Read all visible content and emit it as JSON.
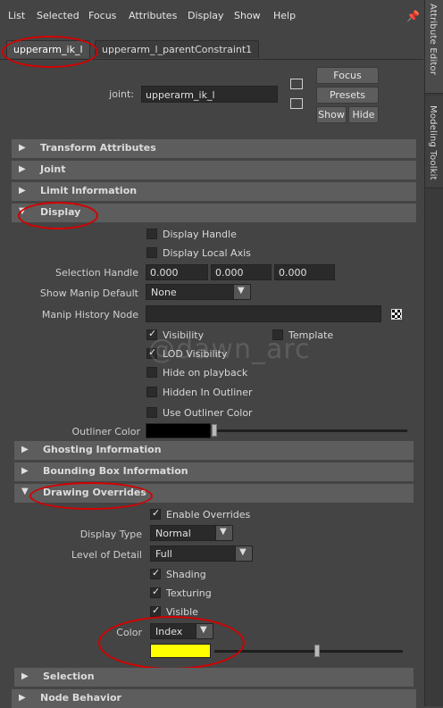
{
  "menu": {
    "items": [
      "List",
      "Selected",
      "Focus",
      "Attributes",
      "Display",
      "Show",
      "Help"
    ]
  },
  "side_tabs": [
    "Attribute Editor",
    "Modeling Toolkit"
  ],
  "node_tabs": [
    "upperarm_ik_l",
    "upperarm_l_parentConstraint1"
  ],
  "joint": {
    "label": "joint:",
    "value": "upperarm_ik_l",
    "buttons": {
      "focus": "Focus",
      "presets": "Presets",
      "show": "Show",
      "hide": "Hide"
    }
  },
  "sections": {
    "transform": "Transform Attributes",
    "joint": "Joint",
    "limit": "Limit Information",
    "display": "Display",
    "ghosting": "Ghosting Information",
    "bounding": "Bounding Box Information",
    "drawing": "Drawing Overrides",
    "selection": "Selection",
    "node_behavior": "Node Behavior"
  },
  "display": {
    "display_handle": "Display Handle",
    "display_local_axis": "Display Local Axis",
    "selection_handle_label": "Selection Handle",
    "selection_handle_values": [
      "0.000",
      "0.000",
      "0.000"
    ],
    "show_manip_label": "Show Manip Default",
    "show_manip_value": "None",
    "manip_history_label": "Manip History Node",
    "visibility": "Visibility",
    "template": "Template",
    "lod_visibility": "LOD Visibility",
    "hide_on_playback": "Hide on playback",
    "hidden_in_outliner": "Hidden In Outliner",
    "use_outliner_color": "Use Outliner Color",
    "outliner_color_label": "Outliner Color",
    "outliner_color": "#000000"
  },
  "drawing": {
    "enable_overrides": "Enable Overrides",
    "display_type_label": "Display Type",
    "display_type_value": "Normal",
    "lod_label": "Level of Detail",
    "lod_value": "Full",
    "shading": "Shading",
    "texturing": "Texturing",
    "visible": "Visible",
    "color_label": "Color",
    "color_value": "Index",
    "color_swatch": "#ffff00"
  },
  "watermark": "@dawn_arc",
  "colors": {
    "annotation": "#d40000",
    "panel": "#444444",
    "header": "#5d5d5d"
  }
}
